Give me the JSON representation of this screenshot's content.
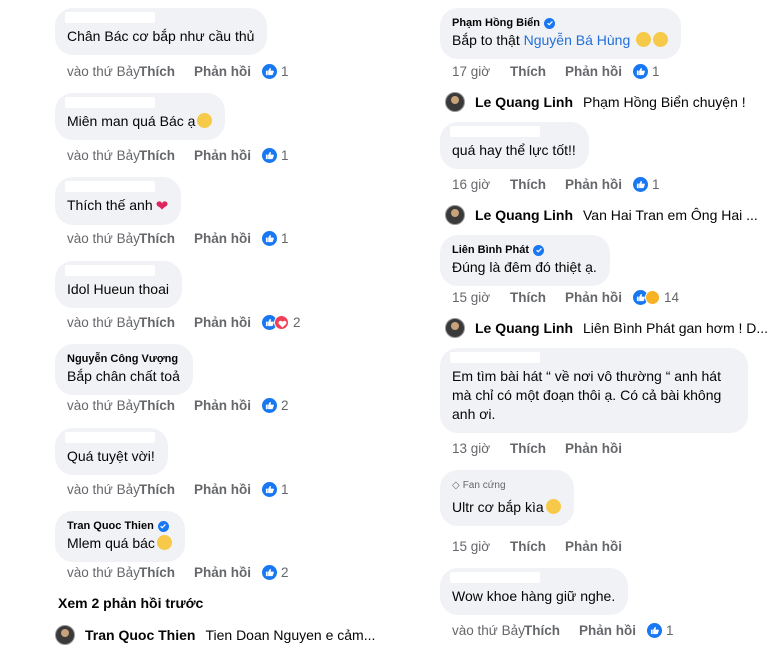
{
  "left": {
    "comments": [
      {
        "name": "",
        "text": "Chân Bác cơ bắp như cầu thủ",
        "emoji": "",
        "time": "vào thứ Bảy",
        "like": "Thích",
        "reply": "Phản hồi",
        "reacts": [
          "like"
        ],
        "count": "1"
      },
      {
        "name": "",
        "text": "Miên man quá Bác ạ",
        "emoji": "smile",
        "time": "vào thứ Bảy",
        "like": "Thích",
        "reply": "Phản hồi",
        "reacts": [
          "like"
        ],
        "count": "1"
      },
      {
        "name": "",
        "text": "Thích thế anh",
        "emoji": "heart",
        "time": "vào thứ Bảy",
        "like": "Thích",
        "reply": "Phản hồi",
        "reacts": [
          "like"
        ],
        "count": "1"
      },
      {
        "name": "",
        "text": "Idol Hueun thoai",
        "emoji": "",
        "time": "vào thứ Bảy",
        "like": "Thích",
        "reply": "Phản hồi",
        "reacts": [
          "like",
          "love"
        ],
        "count": "2"
      },
      {
        "name": "Nguyễn Công Vượng",
        "text": "Bắp chân chất toả",
        "emoji": "",
        "time": "vào thứ Bảy",
        "like": "Thích",
        "reply": "Phản hồi",
        "reacts": [
          "like"
        ],
        "count": "2"
      },
      {
        "name": "",
        "text": "Quá tuyệt vời!",
        "emoji": "",
        "time": "vào thứ Bảy",
        "like": "Thích",
        "reply": "Phản hồi",
        "reacts": [
          "like"
        ],
        "count": "1"
      },
      {
        "name": "Tran Quoc Thien",
        "verified": true,
        "text": "Mlem quá bác",
        "emoji": "grin",
        "time": "vào thứ Bảy",
        "like": "Thích",
        "reply": "Phản hồi",
        "reacts": [
          "like"
        ],
        "count": "2"
      }
    ],
    "more_replies": "Xem 2 phản hồi trước",
    "reply_author": "Tran Quoc Thien",
    "reply_text": "Tien Doan Nguyen e cảm..."
  },
  "right": {
    "c1": {
      "name": "Phạm Hồng Biển",
      "text_prefix": "Bắp to thật",
      "mention": "Nguyễn Bá Hùng",
      "time": "17 giờ",
      "like": "Thích",
      "reply": "Phản hồi",
      "count": "1"
    },
    "r1": {
      "author": "Le Quang Linh",
      "text": "Phạm Hồng Biển chuyện !"
    },
    "c2": {
      "text": "quá hay thể lực tốt!!",
      "time": "16 giờ",
      "like": "Thích",
      "reply": "Phản hồi",
      "count": "1"
    },
    "r2": {
      "author": "Le Quang Linh",
      "text": "Van Hai Tran em Ông Hai ..."
    },
    "c3": {
      "name": "Liên Bình Phát",
      "text": "Đúng là đêm đó thiệt ạ.",
      "time": "15 giờ",
      "like": "Thích",
      "reply": "Phản hồi",
      "count": "14"
    },
    "r3": {
      "author": "Le Quang Linh",
      "text": "Liên Bình Phát gan hơm ! D..."
    },
    "c4": {
      "line1": "Em tìm bài hát “ về nơi vô thường “ anh hát",
      "line2": "mà chỉ có một đoạn thôi ạ. Có cả bài không",
      "line3": "anh ơi.",
      "time": "13 giờ",
      "like": "Thích",
      "reply": "Phản hồi"
    },
    "c5": {
      "badge": "Fan cứng",
      "text": "Ultr cơ bắp kìa",
      "time": "15 giờ",
      "like": "Thích",
      "reply": "Phản hồi"
    },
    "c6": {
      "text": "Wow khoe hàng giữ nghe.",
      "time": "vào thứ Bảy",
      "like": "Thích",
      "reply": "Phản hồi",
      "count": "1"
    }
  },
  "colors": {
    "bubble": "#f0f2f5",
    "meta": "#65676b",
    "link": "#216fdb",
    "like_blue": "#1877f2",
    "love_red": "#f33e58"
  }
}
